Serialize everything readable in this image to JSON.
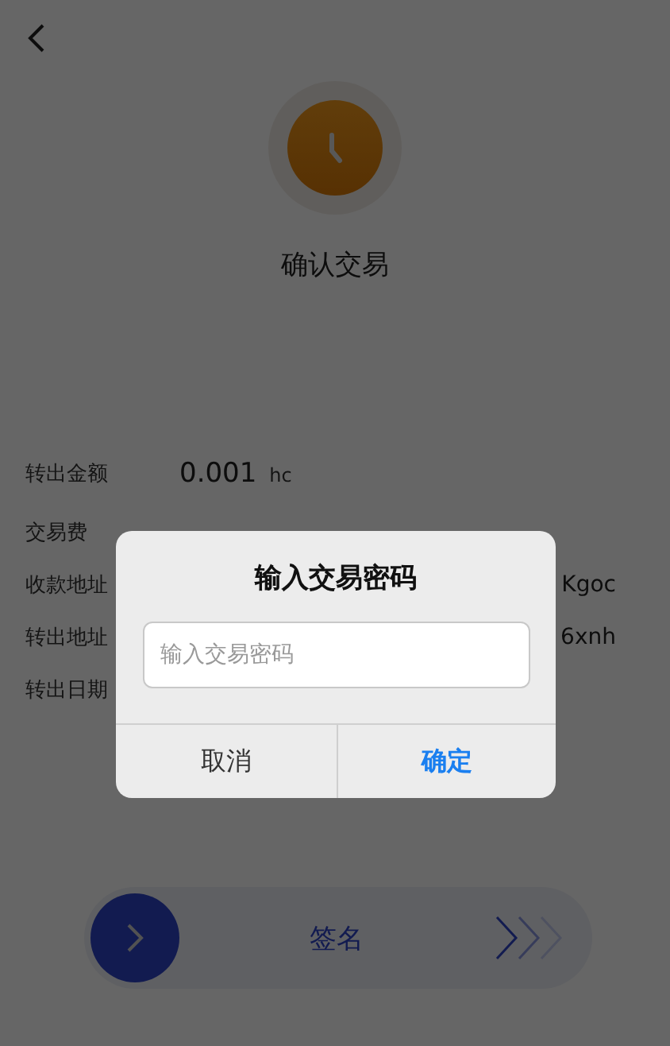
{
  "header": {
    "title": "确认交易"
  },
  "details": [
    {
      "label": "转出金额",
      "value": "0.001",
      "unit": "hc",
      "kind": "amount"
    },
    {
      "label": "交易费",
      "kind": "label"
    },
    {
      "label": "收款地址",
      "value": "Kgoc",
      "kind": "tail"
    },
    {
      "label": "转出地址",
      "value": "6xnh",
      "kind": "tail"
    },
    {
      "label": "转出日期",
      "kind": "label"
    }
  ],
  "slider": {
    "label": "签名"
  },
  "dialog": {
    "title": "输入交易密码",
    "input": {
      "placeholder": "输入交易密码"
    },
    "buttons": [
      {
        "label": "取消",
        "kind": "cancel"
      },
      {
        "label": "确定",
        "kind": "confirm"
      }
    ]
  }
}
